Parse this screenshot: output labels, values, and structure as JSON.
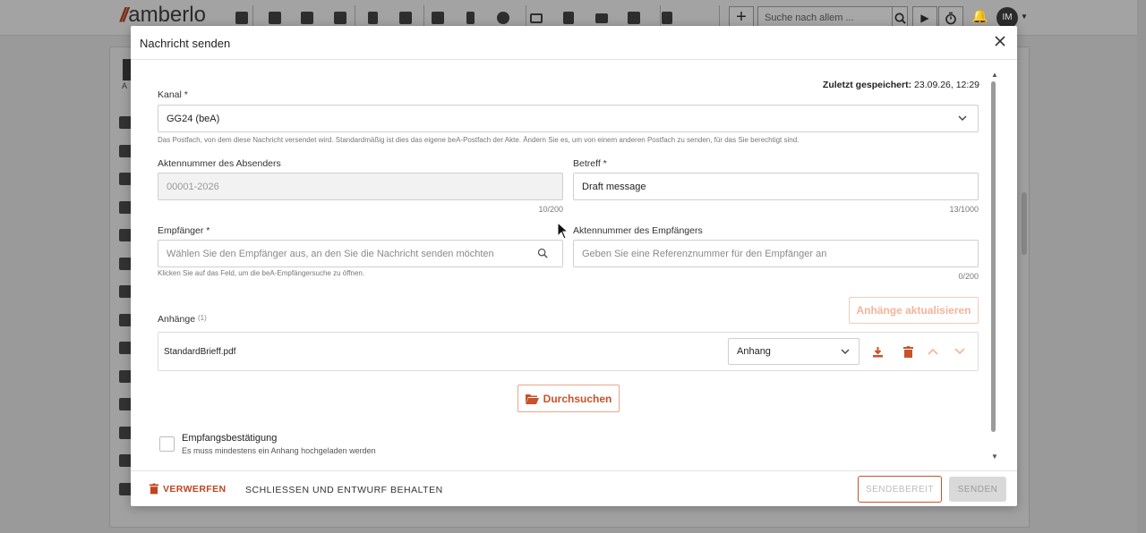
{
  "app": {
    "logo_text": "amberlo",
    "search_placeholder": "Suche nach allem ...",
    "avatar_initials": "IM",
    "nav_icons": [
      "dashboard-icon",
      "contacts-icon",
      "briefcase-icon",
      "tasks-icon",
      "invoice-icon",
      "bank-icon",
      "calendar-icon",
      "hourglass-icon",
      "history-icon",
      "folder-icon",
      "document-search-icon",
      "mail-icon",
      "inbox-icon",
      "chart-icon"
    ],
    "side_first_label": "A"
  },
  "modal": {
    "title": "Nachricht senden",
    "last_saved_label": "Zuletzt gespeichert:",
    "last_saved_value": "23.09.26, 12:29",
    "channel": {
      "label": "Kanal *",
      "value": "GG24 (beA)",
      "hint": "Das Postfach, von dem diese Nachricht versendet wird. Standardmäßig ist dies das eigene beA-Postfach der Akte. Ändern Sie es, um von einem anderen Postfach zu senden, für das Sie berechtigt sind."
    },
    "sender_ref": {
      "label": "Aktennummer des Absenders",
      "value": "00001-2026",
      "counter": "10/200"
    },
    "subject": {
      "label": "Betreff *",
      "value": "Draft message",
      "counter": "13/1000"
    },
    "recipient": {
      "label": "Empfänger *",
      "placeholder": "Wählen Sie den Empfänger aus, an den Sie die Nachricht senden möchten",
      "hint": "Klicken Sie auf das Feld, um die beA-Empfängersuche zu öffnen."
    },
    "recipient_ref": {
      "label": "Aktennummer des Empfängers",
      "placeholder": "Geben Sie eine Referenznummer für den Empfänger an",
      "counter": "0/200"
    },
    "attachments": {
      "label": "Anhänge",
      "count": "(1)",
      "refresh_button": "Anhänge aktualisieren",
      "items": [
        {
          "name": "StandardBrieff.pdf",
          "type": "Anhang"
        }
      ],
      "browse_button": "Durchsuchen"
    },
    "receipt": {
      "label": "Empfangsbestätigung",
      "hint": "Es muss mindestens ein Anhang hochgeladen werden"
    },
    "footer": {
      "discard": "VERWERFEN",
      "close_keep": "SCHLIESSEN UND ENTWURF BEHALTEN",
      "ready": "SENDEBEREIT",
      "send": "SENDEN"
    }
  },
  "colors": {
    "accent": "#c8522a",
    "accent_light": "#f3b49a",
    "overlay": "#9a9a9a"
  }
}
